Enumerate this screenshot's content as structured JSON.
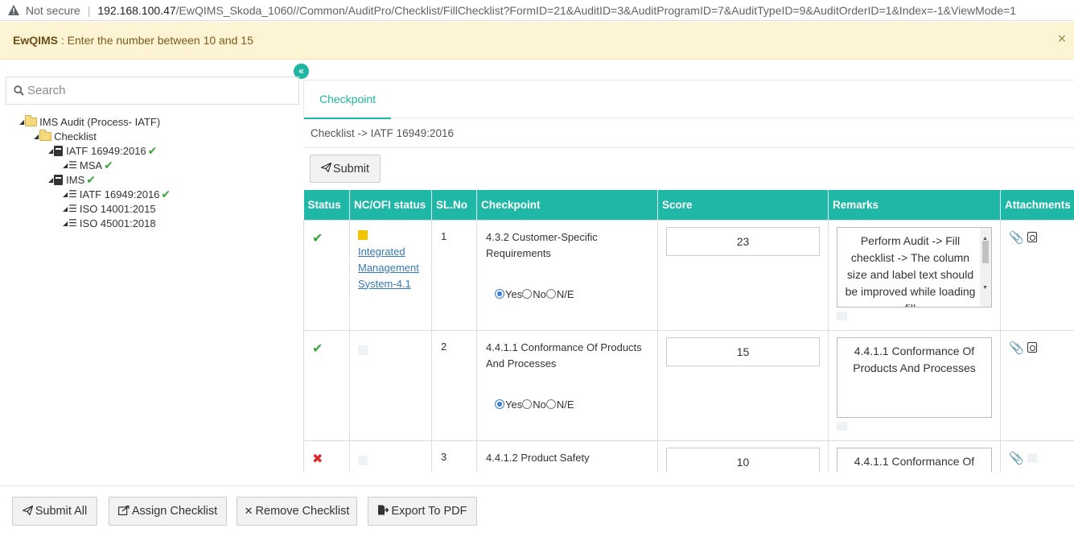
{
  "browser": {
    "security_label": "Not secure",
    "host": "192.168.100.47",
    "path": "/EwQIMS_Skoda_1060//Common/AuditPro/Checklist/FillChecklist?FormID=21&AuditID=3&AuditProgramID=7&AuditTypeID=9&AuditOrderID=1&Index=-1&ViewMode=1"
  },
  "notification": {
    "app_name": "EwQIMS",
    "message": " : Enter the number between 10 and 15",
    "close": "×"
  },
  "sidebar": {
    "collapse_glyph": "«",
    "search_placeholder": "Search",
    "tree": {
      "root": "IMS Audit (Process- IATF)",
      "checklist": "Checklist",
      "iatf": "IATF 16949:2016",
      "msa": "MSA",
      "ims": "IMS",
      "ims_iatf": "IATF 16949:2016",
      "iso14001": "ISO 14001:2015",
      "iso45001": "ISO 45001:2018"
    }
  },
  "main": {
    "tab_label": "Checkpoint",
    "breadcrumb": "Checklist -> IATF 16949:2016",
    "submit_label": "Submit"
  },
  "table": {
    "headers": [
      "Status",
      "NC/OFI status",
      "SL.No",
      "Checkpoint",
      "Score",
      "Remarks",
      "Attachments"
    ],
    "radio_labels": [
      "Yes",
      "No",
      "N/E"
    ],
    "rows": [
      {
        "status": "ok",
        "nc_link": "Integrated Management System-4.1",
        "sl": "1",
        "checkpoint": "4.3.2 Customer-Specific Requirements",
        "answer": "Yes",
        "score": "23",
        "remarks": "Perform Audit -> Fill checklist -> The column size and label text should be improved while loading fill"
      },
      {
        "status": "ok",
        "nc_link": "",
        "sl": "2",
        "checkpoint": "4.4.1.1 Conformance Of Products And Processes",
        "answer": "Yes",
        "score": "15",
        "remarks": "4.4.1.1 Conformance Of Products And Processes"
      },
      {
        "status": "bad",
        "nc_link": "",
        "sl": "3",
        "checkpoint": "4.4.1.2 Product Safety",
        "answer": "",
        "score": "10",
        "remarks": "4.4.1.1 Conformance Of"
      }
    ]
  },
  "footer": {
    "submit_all": "Submit All",
    "assign": "Assign Checklist",
    "remove": "Remove Checklist",
    "export": "Export To PDF"
  },
  "colors": {
    "accent": "#1fb8a6",
    "notify_bg": "#fcf4d2",
    "ok": "#3aa53a",
    "bad": "#d9262a",
    "nc_flag": "#f4c400",
    "link": "#337ab7"
  }
}
